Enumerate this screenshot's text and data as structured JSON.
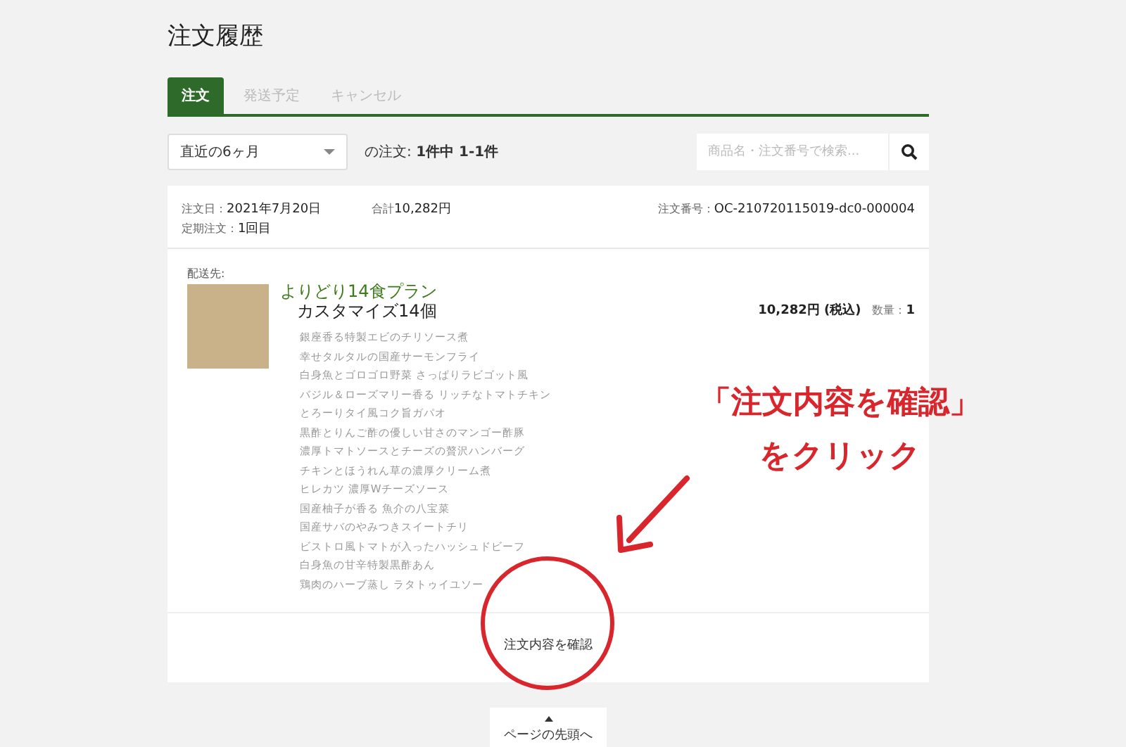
{
  "page_title": "注文履歴",
  "tabs": [
    {
      "label": "注文",
      "selected": true
    },
    {
      "label": "発送予定",
      "selected": false
    },
    {
      "label": "キャンセル",
      "selected": false
    }
  ],
  "period_select": {
    "value": "直近の6ヶ月"
  },
  "order_count": "の注文: **1件中 1-1件**",
  "search": {
    "placeholder": "商品名・注文番号で検索..."
  },
  "order": {
    "date_label": "注文日：",
    "date": "2021年7月20日",
    "subscription_label": "定期注文：",
    "subscription": "1回目",
    "total_label": "合計",
    "total": "10,282円",
    "number_label": "注文番号：",
    "number": "OC-210720115019-dc0-000004",
    "ship_to_label": "配送先:",
    "product_name": "よりどり14食プラン",
    "product_option": "カスタマイズ14個",
    "menu_items": [
      {
        "text": "銀座香る特製エビのチリソース煮"
      },
      {
        "text": "幸せタルタルの国産サーモンフライ"
      },
      {
        "text": "白身魚とゴロゴロ野菜 さっぱりラビゴット風"
      },
      {
        "text": "バジル＆ローズマリー香る リッチなトマトチキン"
      },
      {
        "text": "とろーりタイ風コク旨ガパオ"
      },
      {
        "text": "黒酢とりんご酢の優しい甘さのマンゴー酢豚"
      },
      {
        "text": "濃厚トマトソースとチーズの贅沢ハンバーグ"
      },
      {
        "text": "チキンとほうれん草の濃厚クリーム煮"
      },
      {
        "text": "ヒレカツ 濃厚Wチーズソース"
      },
      {
        "text": "国産柚子が香る 魚介の八宝菜"
      },
      {
        "text": "国産サバのやみつきスイートチリ"
      },
      {
        "text": "ビストロ風トマトが入ったハッシュドビーフ"
      },
      {
        "text": "白身魚の甘辛特製黒酢あん"
      },
      {
        "text": "鶏肉のハーブ蒸し ラタトゥイユソー"
      }
    ],
    "price": "10,282円 (税込)",
    "quantity_label": "数量：",
    "quantity": "1",
    "confirm_button": "注文内容を確認"
  },
  "back_to_top": "ページの先頭へ",
  "annotation": {
    "line1": "「注文内容を確認」",
    "line2": "をクリック"
  }
}
